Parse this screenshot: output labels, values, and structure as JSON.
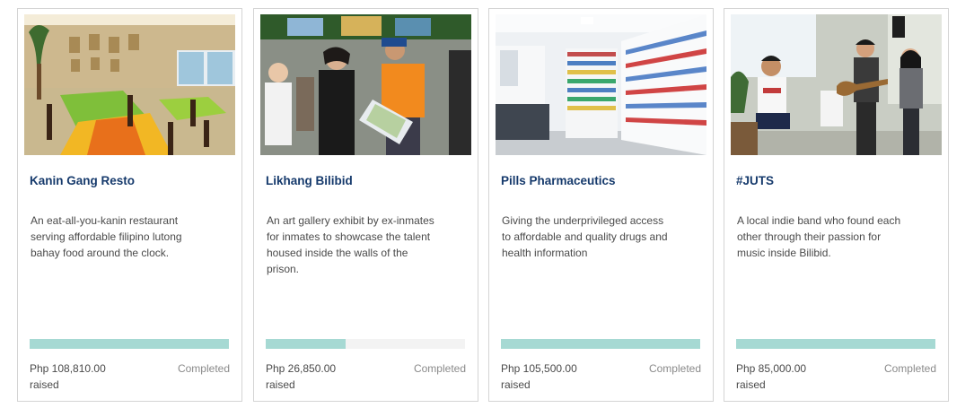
{
  "cards": [
    {
      "title": "Kanin Gang Resto",
      "description": "An eat-all-you-kanin restaurant serving affordable filipino lutong bahay food around the clock.",
      "amount": "Php 108,810.00",
      "raised_label": "raised",
      "status": "Completed",
      "progress_percent": 100
    },
    {
      "title": "Likhang Bilibid",
      "description": "An art gallery exhibit by ex-inmates for inmates to showcase the talent housed inside the walls of the prison.",
      "amount": "Php 26,850.00",
      "raised_label": "raised",
      "status": "Completed",
      "progress_percent": 40
    },
    {
      "title": "Pills Pharmaceutics",
      "description": "Giving the underprivileged access to affordable and quality drugs and health information",
      "amount": "Php 105,500.00",
      "raised_label": "raised",
      "status": "Completed",
      "progress_percent": 100
    },
    {
      "title": "#JUTS",
      "description": "A local indie band who found each other through their passion for music inside Bilibid.",
      "amount": "Php 85,000.00",
      "raised_label": "raised",
      "status": "Completed",
      "progress_percent": 100
    }
  ],
  "colors": {
    "title": "#163a6c",
    "progress_fill": "#a6d9d3",
    "progress_track": "#f3f3f3",
    "card_border": "#d4d4d4"
  }
}
